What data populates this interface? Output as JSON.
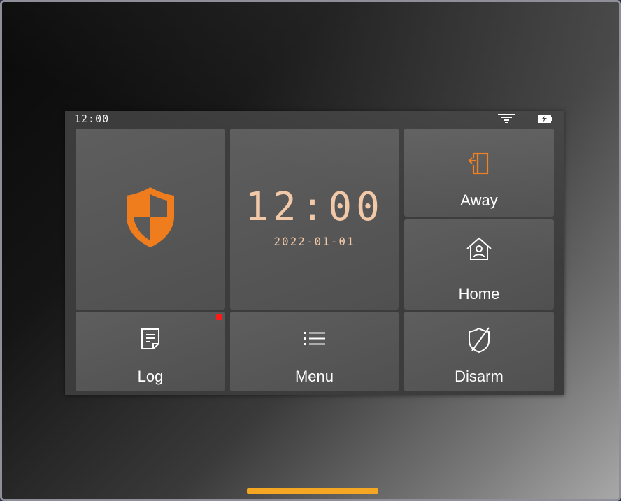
{
  "status_bar": {
    "time": "12:00",
    "signal_icon": "signal-icon",
    "battery_icon": "battery-charging-icon"
  },
  "security_tile": {
    "icon": "shield-icon",
    "accent": "#f07d1d"
  },
  "clock_tile": {
    "time": "12:00",
    "date": "2022-01-01",
    "color": "#f2c9a8"
  },
  "away_tile": {
    "label": "Away",
    "icon": "door-exit-icon",
    "icon_color": "#f07d1d"
  },
  "home_tile": {
    "label": "Home",
    "icon": "house-person-icon"
  },
  "log_tile": {
    "label": "Log",
    "icon": "document-icon",
    "notification_color": "#ff1a1a"
  },
  "menu_tile": {
    "label": "Menu",
    "icon": "list-icon"
  },
  "disarm_tile": {
    "label": "Disarm",
    "icon": "shield-off-icon"
  },
  "home_indicator_color": "#f5a623"
}
